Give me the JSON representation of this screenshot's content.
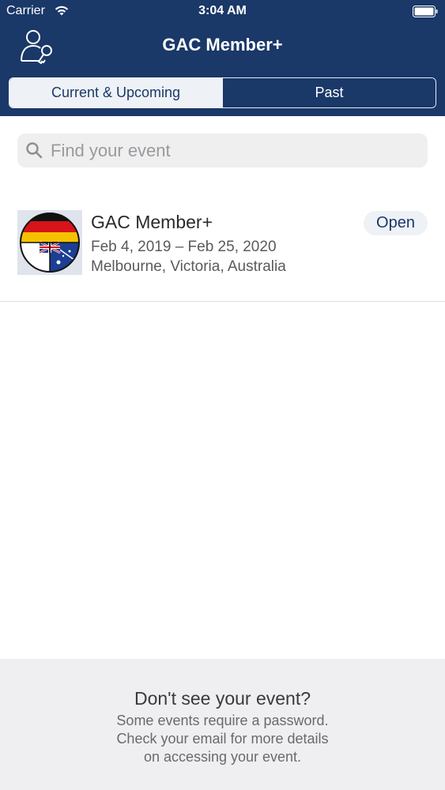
{
  "status_bar": {
    "carrier": "Carrier",
    "time": "3:04 AM"
  },
  "nav": {
    "title": "GAC Member+"
  },
  "tabs": [
    {
      "label": "Current & Upcoming",
      "selected": true
    },
    {
      "label": "Past",
      "selected": false
    }
  ],
  "search": {
    "placeholder": "Find your event",
    "value": ""
  },
  "events": [
    {
      "name": "GAC Member+",
      "dates": "Feb 4, 2019 – Feb 25, 2020",
      "location": "Melbourne, Victoria, Australia",
      "action": "Open"
    }
  ],
  "footer": {
    "title": "Don't see your event?",
    "lines": [
      "Some events require a password.",
      "Check your email for more details",
      "on accessing your event."
    ]
  },
  "colors": {
    "header": "#1a3868",
    "accent": "#1a3868",
    "footer_bg": "#efeff2"
  },
  "icons": [
    "wifi-icon",
    "battery-icon",
    "profile-key-icon",
    "search-icon"
  ]
}
